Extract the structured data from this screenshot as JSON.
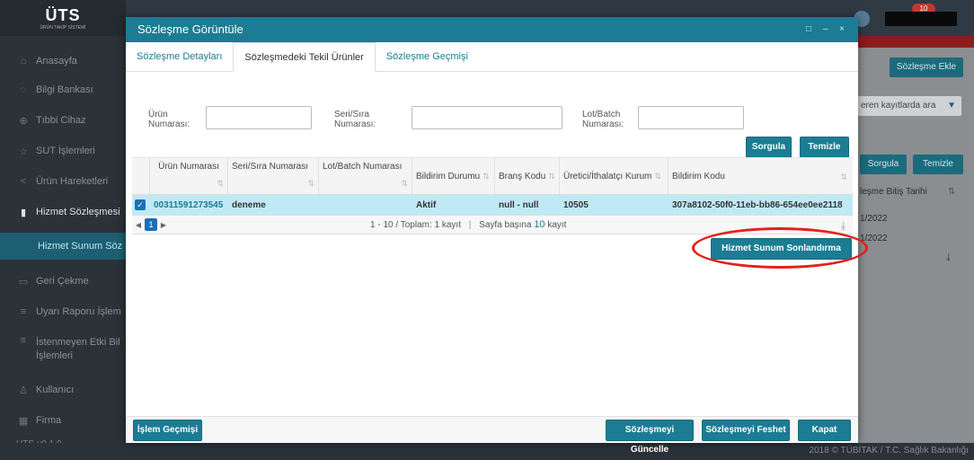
{
  "app": {
    "logo": "ÜTS",
    "logo_sub": "ÜRÜN TAKİP SİSTEMİ",
    "version": "UTS-v9.1.0",
    "notification_count": "10",
    "footer_copy": "2018 © TÜBİTAK / T.C. Sağlık Bakanlığı"
  },
  "sidebar": {
    "items": [
      {
        "label": "Anasayfa",
        "icon": "home-icon"
      },
      {
        "label": "Bilgi Bankası",
        "icon": "bulb-icon"
      },
      {
        "label": "Tıbbi Cihaz",
        "icon": "plus-circle-icon"
      },
      {
        "label": "SUT İşlemleri",
        "icon": "star-icon"
      },
      {
        "label": "Ürün Hareketleri",
        "icon": "share-icon"
      },
      {
        "label": "Hizmet Sözleşmesi",
        "icon": "file-icon"
      },
      {
        "label": "Hizmet Sunum Söz",
        "icon": ""
      },
      {
        "label": "Geri Çekme",
        "icon": "return-icon"
      },
      {
        "label": "Uyarı Raporu İşlem",
        "icon": "doc-icon"
      },
      {
        "label": "İstenmeyen Etki Bil İşlemleri",
        "icon": "doc-icon"
      },
      {
        "label": "Kullanıcı",
        "icon": "user-icon"
      },
      {
        "label": "Firma",
        "icon": "building-icon"
      }
    ]
  },
  "background": {
    "add_contract_button": "Sözleşme Ekle",
    "search_placeholder": "eren kayıtlarda ara",
    "query_button": "Sorgula",
    "clear_button": "Temizle",
    "col_end_date": "leşme Bitiş Tarihi",
    "row_dates": [
      "1/2022",
      "1/2022"
    ]
  },
  "modal": {
    "title": "Sözleşme Görüntüle",
    "controls": "□ – ×",
    "tabs": [
      {
        "label": "Sözleşme Detayları",
        "active": false
      },
      {
        "label": "Sözleşmedeki Tekil Ürünler",
        "active": true
      },
      {
        "label": "Sözleşme Geçmişi",
        "active": false
      }
    ],
    "filters": {
      "product_no_label": "Ürün Numarası:",
      "serial_no_label": "Seri/Sıra Numarası:",
      "lot_batch_label": "Lot/Batch Numarası:",
      "product_no_value": "",
      "serial_no_value": "",
      "lot_batch_value": ""
    },
    "query_button": "Sorgula",
    "clear_button": "Temizle",
    "grid": {
      "columns": [
        "Ürün Numarası",
        "Seri/Sıra Numarası",
        "Lot/Batch Numarası",
        "Bildirim Durumu",
        "Branş Kodu",
        "Üretici/İthalatçı Kurum",
        "Bildirim Kodu"
      ],
      "rows": [
        {
          "checked": true,
          "cells": [
            "00311591273545",
            "deneme",
            "",
            "Aktif",
            "null - null",
            "10505",
            "307a8102-50f0-11eb-bb86-654ee0ee2118"
          ]
        }
      ],
      "pager": {
        "page": "1",
        "range": "1 - 10 / Toplam: 1 kayıt",
        "separator": "|",
        "per_page_label": "Sayfa başına",
        "per_page": "10",
        "per_page_suffix": "kayıt"
      }
    },
    "end_service_button": "Hizmet Sunum Sonlandırma Bildir",
    "footer": {
      "history_button": "İşlem Geçmişi",
      "update_button": "Sözleşmeyi Güncelle",
      "terminate_button": "Sözleşmeyi Feshet",
      "close_button": "Kapat"
    }
  },
  "colors": {
    "accent": "#1b7c93",
    "selected_row": "#bfeaf5",
    "highlight_ring": "#e3211c"
  }
}
